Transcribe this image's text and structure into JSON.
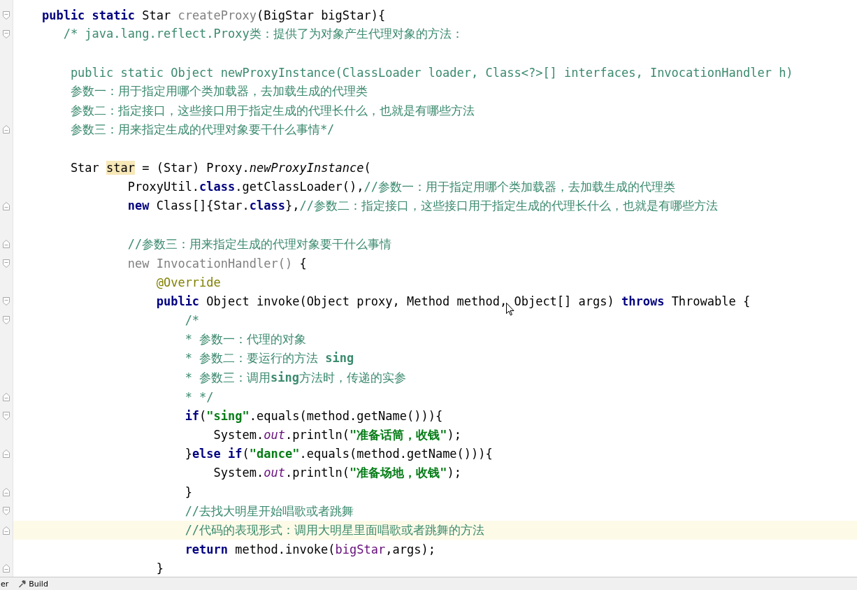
{
  "editor": {
    "lines": [
      {
        "kind": "code",
        "marker": {
          "kind": "fold-start"
        },
        "tokens": [
          {
            "kind": "keyword",
            "text": "    public static"
          },
          {
            "kind": "plain",
            "text": " Star "
          },
          {
            "kind": "unused",
            "text": "createProxy"
          },
          {
            "kind": "plain",
            "text": "(BigStar bigStar){"
          }
        ]
      },
      {
        "kind": "code",
        "marker": {
          "kind": "fold-start"
        },
        "tokens": [
          {
            "kind": "comment",
            "text": "       /* java.lang.reflect.Proxy类：提供了为对象产生代理对象的方法："
          }
        ]
      },
      {
        "kind": "blank"
      },
      {
        "kind": "code",
        "tokens": [
          {
            "kind": "comment",
            "text": "        public static Object newProxyInstance(ClassLoader loader, Class<?>[] interfaces, InvocationHandler h)"
          }
        ]
      },
      {
        "kind": "code",
        "tokens": [
          {
            "kind": "comment",
            "text": "        参数一：用于指定用哪个类加载器，去加载生成的代理类"
          }
        ]
      },
      {
        "kind": "code",
        "tokens": [
          {
            "kind": "comment",
            "text": "        参数二：指定接口，这些接口用于指定生成的代理长什么，也就是有哪些方法"
          }
        ]
      },
      {
        "kind": "code",
        "marker": {
          "kind": "fold-end"
        },
        "tokens": [
          {
            "kind": "comment",
            "text": "        参数三：用来指定生成的代理对象要干什么事情*/"
          }
        ]
      },
      {
        "kind": "blank"
      },
      {
        "kind": "code",
        "tokens": [
          {
            "kind": "plain",
            "text": "        Star "
          },
          {
            "kind": "highlight",
            "text": "star"
          },
          {
            "kind": "plain",
            "text": " = (Star) Proxy."
          },
          {
            "kind": "static",
            "text": "newProxyInstance"
          },
          {
            "kind": "plain",
            "text": "("
          }
        ]
      },
      {
        "kind": "code",
        "tokens": [
          {
            "kind": "plain",
            "text": "                ProxyUtil."
          },
          {
            "kind": "keyword",
            "text": "class"
          },
          {
            "kind": "plain",
            "text": ".getClassLoader(),"
          },
          {
            "kind": "comment",
            "text": "//参数一：用于指定用哪个类加载器，去加载生成的代理类"
          }
        ]
      },
      {
        "kind": "code",
        "marker": {
          "kind": "fold-end"
        },
        "tokens": [
          {
            "kind": "keyword",
            "text": "                new"
          },
          {
            "kind": "plain",
            "text": " Class[]{Star."
          },
          {
            "kind": "keyword",
            "text": "class"
          },
          {
            "kind": "plain",
            "text": "},"
          },
          {
            "kind": "comment",
            "text": "//参数二：指定接口，这些接口用于指定生成的代理长什么，也就是有哪些方法"
          }
        ]
      },
      {
        "kind": "blank"
      },
      {
        "kind": "code",
        "marker": {
          "kind": "fold-end"
        },
        "tokens": [
          {
            "kind": "comment",
            "text": "                //参数三：用来指定生成的代理对象要干什么事情"
          }
        ]
      },
      {
        "kind": "code",
        "marker": {
          "kind": "fold-start"
        },
        "tokens": [
          {
            "kind": "unused",
            "text": "                new InvocationHandler()"
          },
          {
            "kind": "plain",
            "text": " {"
          }
        ]
      },
      {
        "kind": "code",
        "tokens": [
          {
            "kind": "annotation",
            "text": "                    @Override"
          }
        ]
      },
      {
        "kind": "code",
        "marker": {
          "kind": "fold-start"
        },
        "tokens": [
          {
            "kind": "keyword",
            "text": "                    public"
          },
          {
            "kind": "plain",
            "text": " Object invoke(Object proxy, Method method, Object[] args) "
          },
          {
            "kind": "keyword",
            "text": "throws"
          },
          {
            "kind": "plain",
            "text": " Throwable {"
          }
        ]
      },
      {
        "kind": "code",
        "marker": {
          "kind": "fold-start"
        },
        "tokens": [
          {
            "kind": "comment",
            "text": "                        /*"
          }
        ]
      },
      {
        "kind": "code",
        "tokens": [
          {
            "kind": "comment",
            "text": "                        * 参数一：代理的对象"
          }
        ]
      },
      {
        "kind": "code",
        "tokens": [
          {
            "kind": "comment",
            "text": "                        * 参数二：要运行的方法 "
          },
          {
            "kind": "doctag",
            "text": "sing"
          }
        ]
      },
      {
        "kind": "code",
        "tokens": [
          {
            "kind": "comment",
            "text": "                        * 参数三：调用"
          },
          {
            "kind": "doctag",
            "text": "sing"
          },
          {
            "kind": "comment",
            "text": "方法时，传递的实参"
          }
        ]
      },
      {
        "kind": "code",
        "marker": {
          "kind": "fold-end"
        },
        "tokens": [
          {
            "kind": "comment",
            "text": "                        * */"
          }
        ]
      },
      {
        "kind": "code",
        "marker": {
          "kind": "fold-start"
        },
        "tokens": [
          {
            "kind": "keyword",
            "text": "                        if"
          },
          {
            "kind": "plain",
            "text": "("
          },
          {
            "kind": "string",
            "text": "\"sing\""
          },
          {
            "kind": "plain",
            "text": ".equals(method.getName())){"
          }
        ]
      },
      {
        "kind": "code",
        "tokens": [
          {
            "kind": "plain",
            "text": "                            System."
          },
          {
            "kind": "field",
            "text": "out"
          },
          {
            "kind": "plain",
            "text": ".println("
          },
          {
            "kind": "string",
            "text": "\"准备话筒，收钱\""
          },
          {
            "kind": "plain",
            "text": ");"
          }
        ]
      },
      {
        "kind": "code",
        "marker": {
          "kind": "fold-end"
        },
        "tokens": [
          {
            "kind": "plain",
            "text": "                        }"
          },
          {
            "kind": "keyword",
            "text": "else if"
          },
          {
            "kind": "plain",
            "text": "("
          },
          {
            "kind": "string",
            "text": "\"dance\""
          },
          {
            "kind": "plain",
            "text": ".equals(method.getName())){"
          }
        ]
      },
      {
        "kind": "code",
        "tokens": [
          {
            "kind": "plain",
            "text": "                            System."
          },
          {
            "kind": "field",
            "text": "out"
          },
          {
            "kind": "plain",
            "text": ".println("
          },
          {
            "kind": "string",
            "text": "\"准备场地，收钱\""
          },
          {
            "kind": "plain",
            "text": ");"
          }
        ]
      },
      {
        "kind": "code",
        "marker": {
          "kind": "fold-end"
        },
        "tokens": [
          {
            "kind": "plain",
            "text": "                        }"
          }
        ]
      },
      {
        "kind": "code",
        "marker": {
          "kind": "fold-start"
        },
        "tokens": [
          {
            "kind": "comment",
            "text": "                        //去找大明星开始唱歌或者跳舞"
          }
        ]
      },
      {
        "kind": "code",
        "marker": {
          "kind": "fold-end"
        },
        "current": true,
        "tokens": [
          {
            "kind": "comment",
            "text": "                        //代码的表现形式：调用大明星里面唱歌或者跳舞的方法"
          }
        ]
      },
      {
        "kind": "code",
        "tokens": [
          {
            "kind": "keyword",
            "text": "                        return"
          },
          {
            "kind": "plain",
            "text": " method.invoke("
          },
          {
            "kind": "param",
            "text": "bigStar"
          },
          {
            "kind": "plain",
            "text": ",args);"
          }
        ]
      },
      {
        "kind": "code",
        "marker": {
          "kind": "fold-end"
        },
        "tokens": [
          {
            "kind": "plain",
            "text": "                    }"
          }
        ]
      }
    ]
  },
  "status_bar": {
    "items": [
      {
        "kind": "text",
        "label": "er"
      },
      {
        "kind": "tool",
        "label": "Build"
      }
    ]
  }
}
